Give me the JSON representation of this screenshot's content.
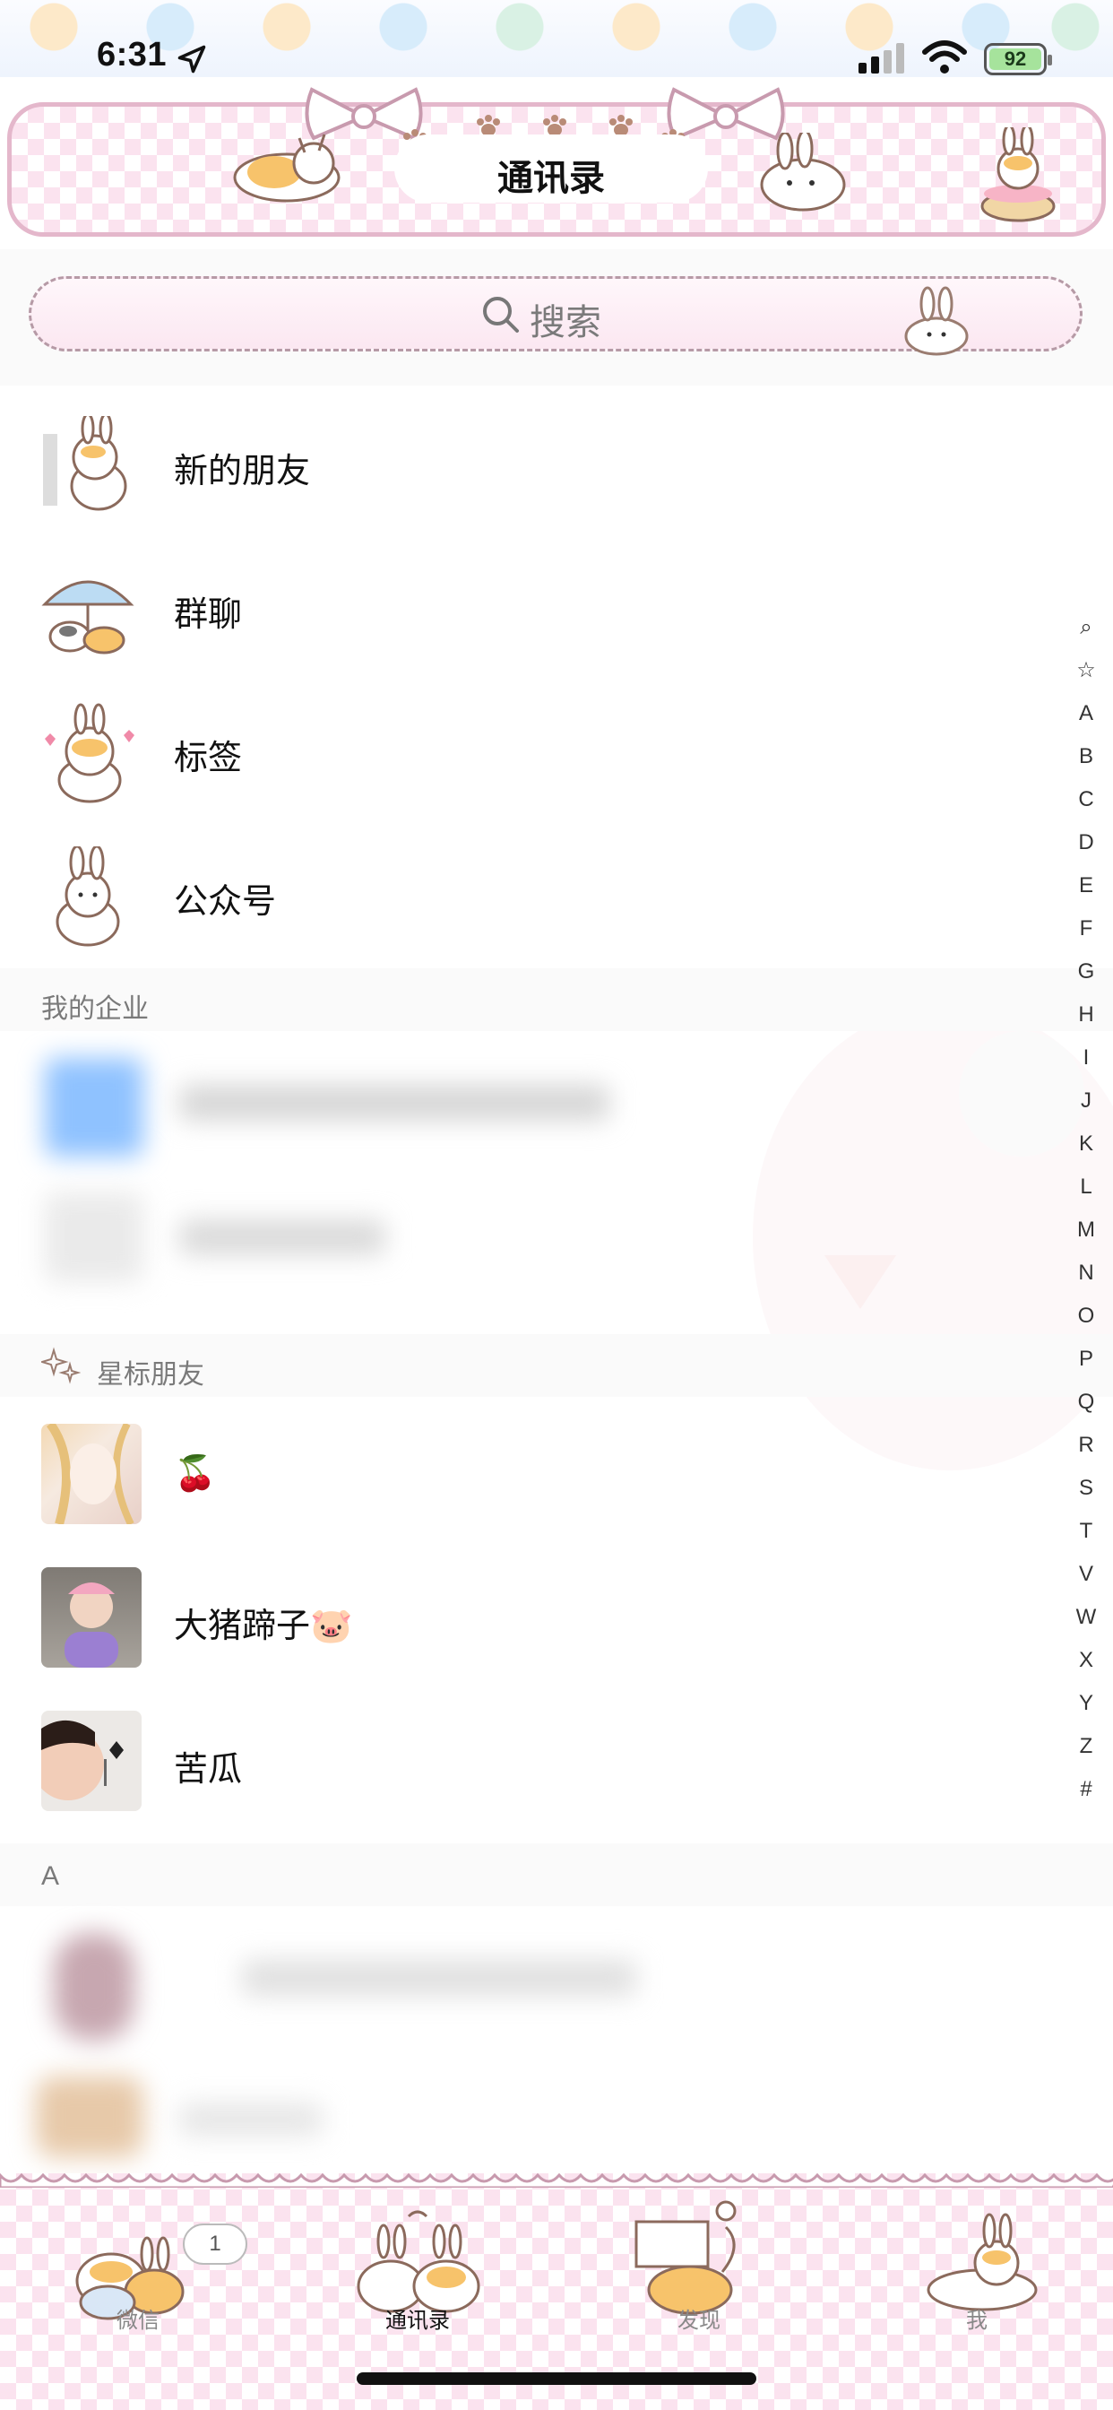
{
  "status_bar": {
    "time": "6:31",
    "battery": "92"
  },
  "header": {
    "title": "通讯录"
  },
  "search": {
    "placeholder": "搜索"
  },
  "menu_items": [
    {
      "label": "新的朋友",
      "icon": "bunny-cat-peeking-icon"
    },
    {
      "label": "群聊",
      "icon": "umbrella-cats-icon"
    },
    {
      "label": "标签",
      "icon": "bunny-cat-hearts-icon"
    },
    {
      "label": "公众号",
      "icon": "white-bunny-icon"
    }
  ],
  "sections": {
    "enterprise": "我的企业",
    "starred": "星标朋友",
    "a": "A"
  },
  "starred_friends": [
    {
      "name": "🍒"
    },
    {
      "name": "大猪蹄子🐷"
    },
    {
      "name": "苦瓜"
    }
  ],
  "index": [
    "Q",
    "☆",
    "A",
    "B",
    "C",
    "D",
    "E",
    "F",
    "G",
    "H",
    "I",
    "J",
    "K",
    "L",
    "M",
    "N",
    "O",
    "P",
    "Q",
    "R",
    "S",
    "T",
    "V",
    "W",
    "X",
    "Y",
    "Z",
    "#"
  ],
  "tabs": [
    {
      "label": "微信",
      "badge": "1",
      "active": false
    },
    {
      "label": "通讯录",
      "active": true
    },
    {
      "label": "发现",
      "active": false
    },
    {
      "label": "我",
      "active": false
    }
  ],
  "colors": {
    "accent_pink": "#fbe3ef",
    "border_pink": "#e4b7cb",
    "text": "#111111",
    "muted": "#7a7a7a"
  }
}
